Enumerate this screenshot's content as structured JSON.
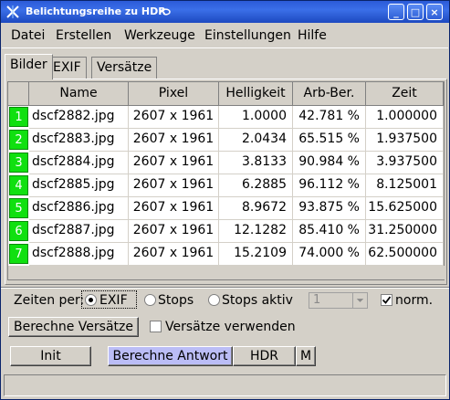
{
  "window": {
    "title": "Belichtungsreihe zu HDR",
    "buttons": {
      "minimize": "_",
      "maximize": "□",
      "close": "×"
    }
  },
  "menu": [
    "Datei",
    "Erstellen",
    "Werkzeuge",
    "Einstellungen",
    "Hilfe"
  ],
  "tabs": [
    "Bilder",
    "EXIF",
    "Versätze"
  ],
  "table": {
    "columns": [
      "Name",
      "Pixel",
      "Helligkeit",
      "Arb-Ber.",
      "Zeit"
    ],
    "rows": [
      {
        "num": "1",
        "name": "dscf2882.jpg",
        "pixel": "2607 x 1961",
        "helligkeit": "1.0000",
        "arb": "42.781 %",
        "zeit": "1.000000"
      },
      {
        "num": "2",
        "name": "dscf2883.jpg",
        "pixel": "2607 x 1961",
        "helligkeit": "2.0434",
        "arb": "65.515 %",
        "zeit": "1.937500"
      },
      {
        "num": "3",
        "name": "dscf2884.jpg",
        "pixel": "2607 x 1961",
        "helligkeit": "3.8133",
        "arb": "90.984 %",
        "zeit": "3.937500"
      },
      {
        "num": "4",
        "name": "dscf2885.jpg",
        "pixel": "2607 x 1961",
        "helligkeit": "6.2885",
        "arb": "96.112 %",
        "zeit": "8.125001"
      },
      {
        "num": "5",
        "name": "dscf2886.jpg",
        "pixel": "2607 x 1961",
        "helligkeit": "8.9672",
        "arb": "93.875 %",
        "zeit": "15.625000"
      },
      {
        "num": "6",
        "name": "dscf2887.jpg",
        "pixel": "2607 x 1961",
        "helligkeit": "12.1282",
        "arb": "85.410 %",
        "zeit": "31.250000"
      },
      {
        "num": "7",
        "name": "dscf2888.jpg",
        "pixel": "2607 x 1961",
        "helligkeit": "15.2109",
        "arb": "74.000 %",
        "zeit": "62.500000"
      }
    ]
  },
  "controls": {
    "zeiten_label": "Zeiten per:",
    "radio_exif": "EXIF",
    "radio_stops": "Stops",
    "radio_stops_aktiv": "Stops aktiv",
    "selected_radio": "EXIF",
    "stops_select_value": "1",
    "norm_label": "norm.",
    "norm_checked": true,
    "berechne_versaetze": "Berechne Versätze",
    "versaetze_verwenden": "Versätze verwenden",
    "versaetze_checked": false
  },
  "bottom_buttons": {
    "init": "Init",
    "berechne_antwort": "Berechne Antwort",
    "hdr": "HDR",
    "m": "M"
  },
  "colors": {
    "titlebar": "#2b5bd8",
    "row_number": "#10e010",
    "highlight_button": "#bbbdf6"
  }
}
